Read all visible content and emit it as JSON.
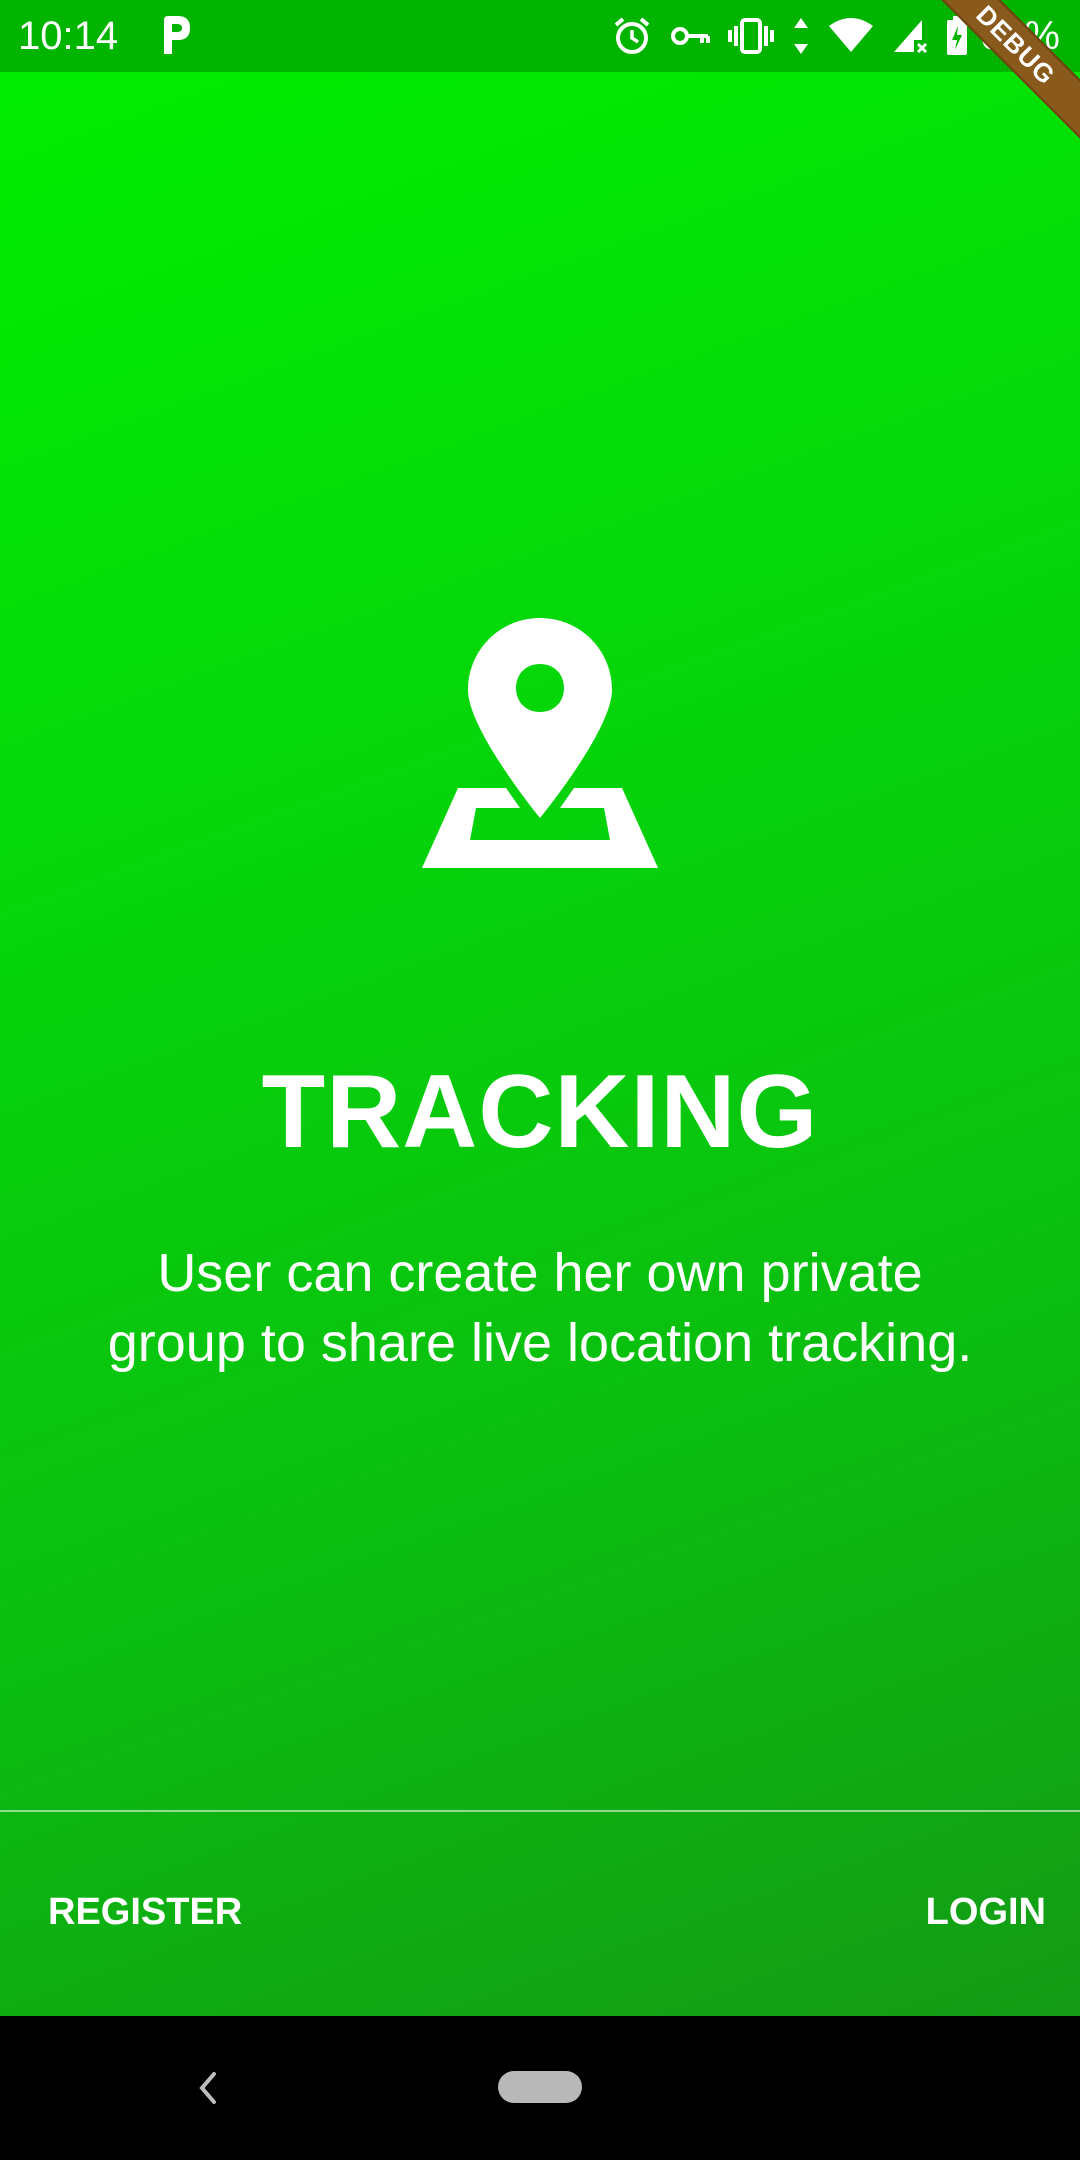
{
  "status_bar": {
    "time": "10:14",
    "battery_percent": "66%",
    "icons": [
      "parking-icon",
      "alarm-icon",
      "vpn-key-icon",
      "vibrate-icon",
      "data-arrows-icon",
      "wifi-icon",
      "signal-icon",
      "battery-icon"
    ]
  },
  "debug_banner": "DEBUG",
  "onboarding": {
    "icon": "map-pin-icon",
    "title": "TRACKING",
    "description": "User can create her own private group to share live location tracking."
  },
  "actions": {
    "register_label": "REGISTER",
    "login_label": "LOGIN"
  },
  "colors": {
    "background_top": "#00f000",
    "background_bottom": "#149a15",
    "status_bar": "#00b400",
    "text": "#ffffff",
    "debug_ribbon": "#8a5a1c"
  }
}
